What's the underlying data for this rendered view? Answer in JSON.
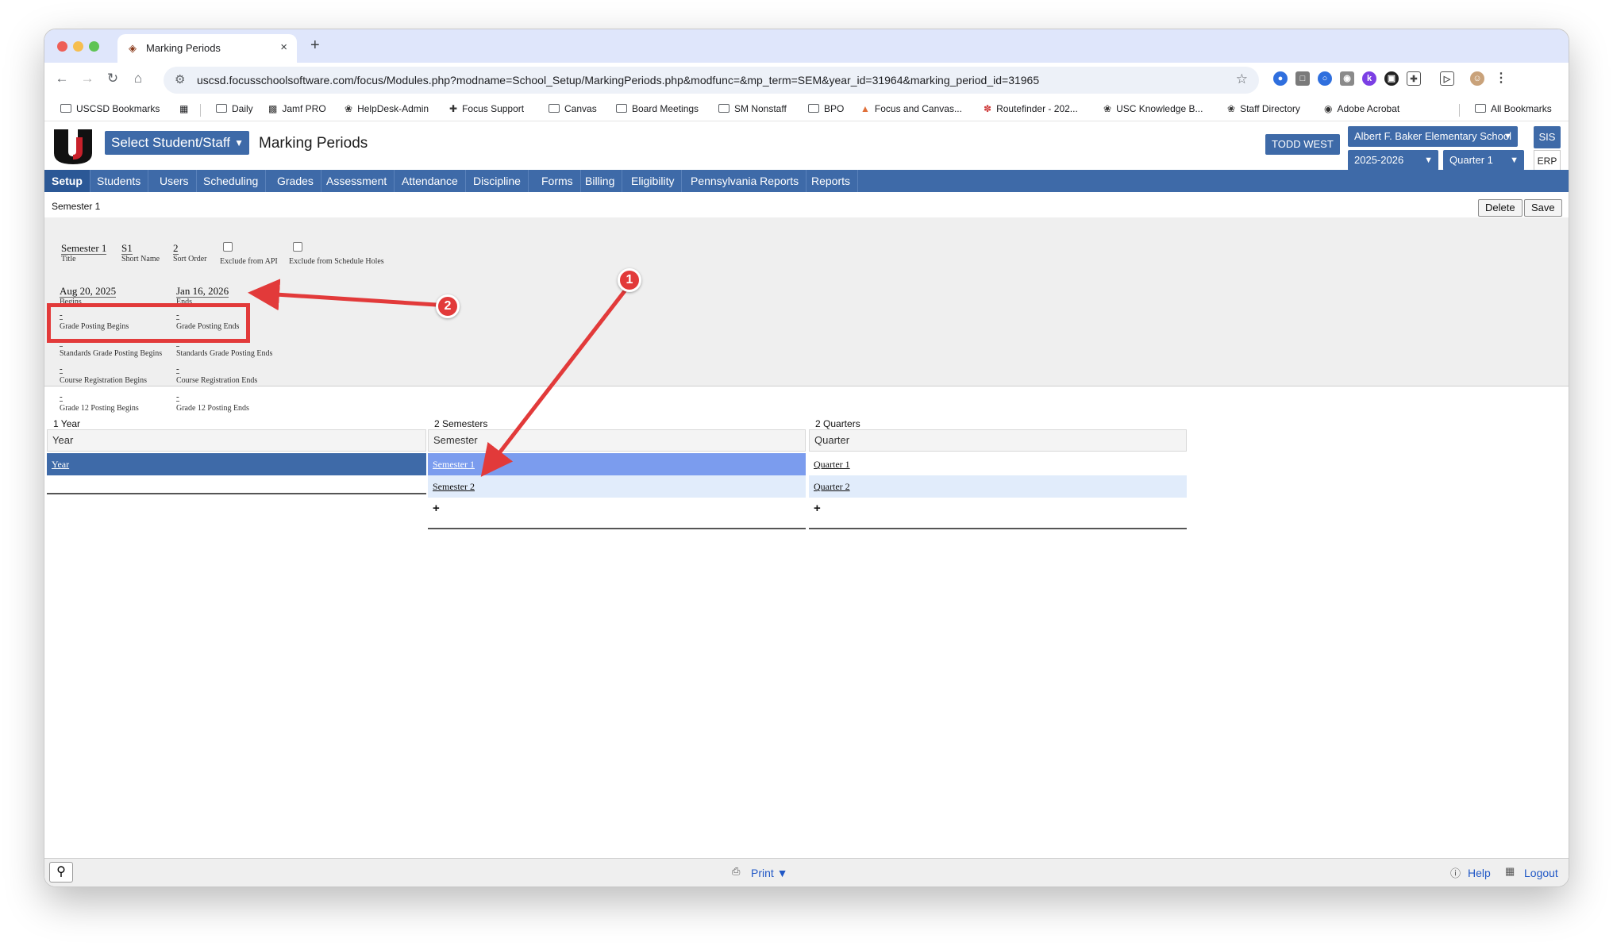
{
  "browser": {
    "tab_title": "Marking Periods",
    "url": "uscsd.focusschoolsoftware.com/focus/Modules.php?modname=School_Setup/MarkingPeriods.php&modfunc=&mp_term=SEM&year_id=31964&marking_period_id=31965",
    "bookmarks": [
      "USCSD Bookmarks",
      "Daily",
      "Jamf PRO",
      "HelpDesk-Admin",
      "Focus Support",
      "Canvas",
      "Board Meetings",
      "SM Nonstaff",
      "BPO",
      "Focus and Canvas...",
      "Routefinder - 202...",
      "USC Knowledge B...",
      "Staff Directory",
      "Adobe Acrobat",
      "All Bookmarks"
    ]
  },
  "header": {
    "select_label": "Select Student/Staff",
    "page_title": "Marking Periods",
    "user": "TODD WEST",
    "school": "Albert F. Baker Elementary School",
    "year": "2025-2026",
    "quarter": "Quarter 1",
    "sis": "SIS",
    "erp": "ERP"
  },
  "menu": [
    "Setup",
    "Students",
    "Users",
    "Scheduling",
    "Grades",
    "Assessment",
    "Attendance",
    "Discipline",
    "Forms",
    "Billing",
    "Eligibility",
    "Pennsylvania Reports",
    "Reports"
  ],
  "period": {
    "name": "Semester 1",
    "delete": "Delete",
    "save": "Save"
  },
  "form": {
    "title_value": "Semester 1",
    "title_label": "Title",
    "short_value": "S1",
    "short_label": "Short Name",
    "sort_value": "2",
    "sort_label": "Sort Order",
    "api_label": "Exclude from API",
    "holes_label": "Exclude from Schedule Holes",
    "begins_value": "Aug 20, 2025",
    "begins_label": "Begins",
    "ends_value": "Jan 16, 2026",
    "ends_label": "Ends",
    "empty": "-",
    "grade_begins": "Grade Posting Begins",
    "grade_ends": "Grade Posting Ends",
    "std_begins": "Standards Grade Posting Begins",
    "std_ends": "Standards Grade Posting Ends",
    "course_begins": "Course Registration Begins",
    "course_ends": "Course Registration Ends",
    "g12_begins": "Grade 12 Posting Begins",
    "g12_ends": "Grade 12 Posting Ends"
  },
  "tables": {
    "year": {
      "caption": "1 Year",
      "header": "Year",
      "rows": [
        "Year"
      ]
    },
    "semesters": {
      "caption": "2 Semesters",
      "header": "Semester",
      "rows": [
        "Semester 1",
        "Semester 2"
      ],
      "add": "+"
    },
    "quarters": {
      "caption": "2 Quarters",
      "header": "Quarter",
      "rows": [
        "Quarter 1",
        "Quarter 2"
      ],
      "add": "+"
    }
  },
  "footer": {
    "print": "Print",
    "help": "Help",
    "logout": "Logout"
  },
  "annotations": [
    "1",
    "2"
  ],
  "colors": {
    "brand": "#3e6aa8",
    "annotation": "#e23a3a",
    "selected_row": "#7b9cee"
  }
}
